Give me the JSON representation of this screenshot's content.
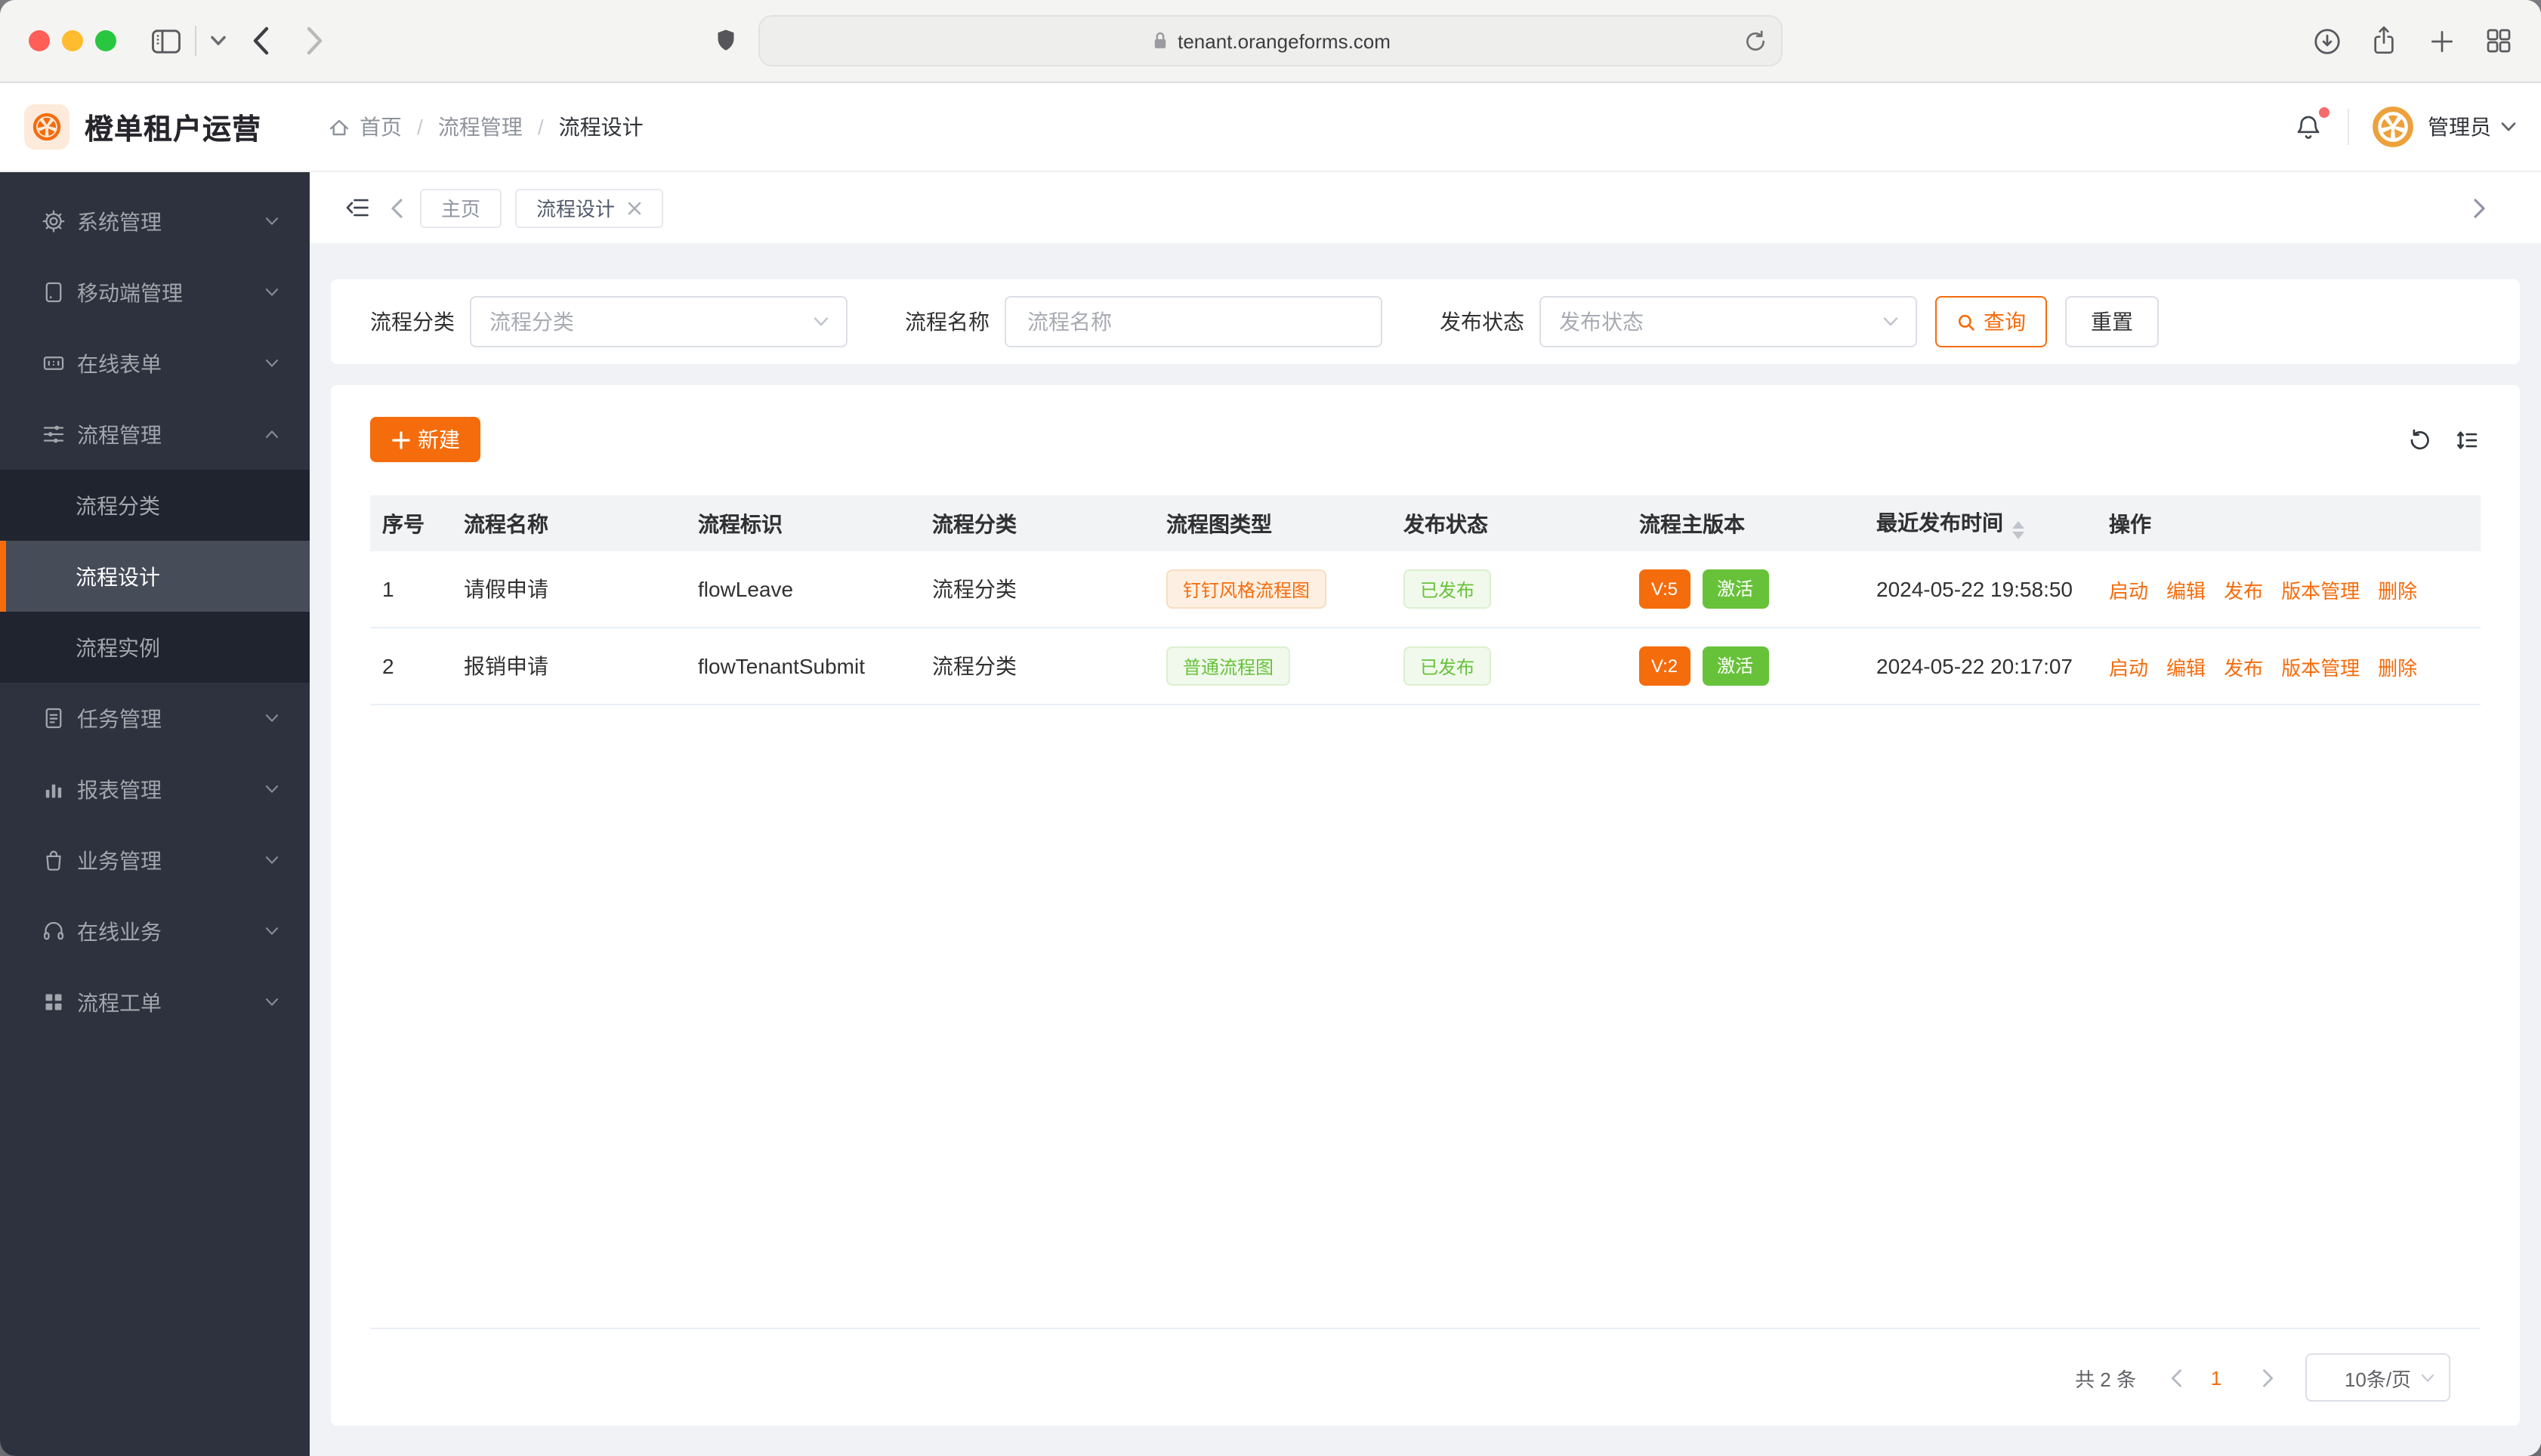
{
  "browser": {
    "url": "tenant.orangeforms.com",
    "icons": [
      "sidebar-toggle-icon",
      "chevron-down-icon",
      "back-icon",
      "forward-icon",
      "shield-icon",
      "lock-icon",
      "reload-icon",
      "download-icon",
      "share-icon",
      "new-tab-icon",
      "tab-overview-icon"
    ]
  },
  "header": {
    "title": "橙单租户运营",
    "logo_icon": "citrus-icon",
    "breadcrumb": {
      "home_icon": "home-icon",
      "items": [
        "首页",
        "流程管理",
        "流程设计"
      ],
      "separator": "/"
    },
    "notifications": {
      "icon": "bell-icon",
      "has_unread": true
    },
    "user": {
      "name": "管理员",
      "avatar_icon": "citrus-icon",
      "caret_icon": "chevron-down-icon"
    }
  },
  "sidebar": {
    "items": [
      {
        "label": "系统管理",
        "icon": "gear-icon",
        "state": "collapsed"
      },
      {
        "label": "移动端管理",
        "icon": "mobile-icon",
        "state": "collapsed"
      },
      {
        "label": "在线表单",
        "icon": "form-icon",
        "state": "collapsed"
      },
      {
        "label": "流程管理",
        "icon": "sliders-icon",
        "state": "expanded",
        "children": [
          {
            "label": "流程分类",
            "active": false
          },
          {
            "label": "流程设计",
            "active": true
          },
          {
            "label": "流程实例",
            "active": false
          }
        ]
      },
      {
        "label": "任务管理",
        "icon": "tasks-icon",
        "state": "collapsed"
      },
      {
        "label": "报表管理",
        "icon": "bar-chart-icon",
        "state": "collapsed"
      },
      {
        "label": "业务管理",
        "icon": "shopping-bag-icon",
        "state": "collapsed"
      },
      {
        "label": "在线业务",
        "icon": "headset-icon",
        "state": "collapsed"
      },
      {
        "label": "流程工单",
        "icon": "grid-icon",
        "state": "collapsed"
      }
    ]
  },
  "tabs": {
    "fold_icon": "menu-fold-icon",
    "items": [
      {
        "label": "主页",
        "closable": false,
        "active": false
      },
      {
        "label": "流程设计",
        "closable": true,
        "active": true
      }
    ]
  },
  "filters": {
    "category": {
      "label": "流程分类",
      "placeholder": "流程分类"
    },
    "name": {
      "label": "流程名称",
      "placeholder": "流程名称"
    },
    "status": {
      "label": "发布状态",
      "placeholder": "发布状态"
    },
    "search_button": "查询",
    "reset_button": "重置"
  },
  "toolbar": {
    "new_button": "新建",
    "icons": [
      "refresh-icon",
      "row-density-icon"
    ]
  },
  "table": {
    "columns": [
      "序号",
      "流程名称",
      "流程标识",
      "流程分类",
      "流程图类型",
      "发布状态",
      "流程主版本",
      "最近发布时间",
      "操作"
    ],
    "sortable_column": "最近发布时间",
    "rows": [
      {
        "index": "1",
        "name": "请假申请",
        "key": "flowLeave",
        "category": "流程分类",
        "diagram_type": {
          "text": "钉钉风格流程图",
          "color": "orange"
        },
        "publish_status": "已发布",
        "version": "V:5",
        "active_status": "激活",
        "published_at": "2024-05-22 19:58:50",
        "actions": [
          "启动",
          "编辑",
          "发布",
          "版本管理",
          "删除"
        ]
      },
      {
        "index": "2",
        "name": "报销申请",
        "key": "flowTenantSubmit",
        "category": "流程分类",
        "diagram_type": {
          "text": "普通流程图",
          "color": "green"
        },
        "publish_status": "已发布",
        "version": "V:2",
        "active_status": "激活",
        "published_at": "2024-05-22 20:17:07",
        "actions": [
          "启动",
          "编辑",
          "发布",
          "版本管理",
          "删除"
        ]
      }
    ]
  },
  "pagination": {
    "total_text": "共 2 条",
    "current_page": "1",
    "page_size": "10条/页"
  },
  "colors": {
    "accent_orange": "#f56c0c",
    "success_green": "#67c23a",
    "sidebar_bg": "#2d323e",
    "sidebar_submenu_bg": "#20242e",
    "sidebar_active_bg": "#474c59",
    "page_bg": "#f0f2f5",
    "danger_red": "#f56c6c"
  }
}
